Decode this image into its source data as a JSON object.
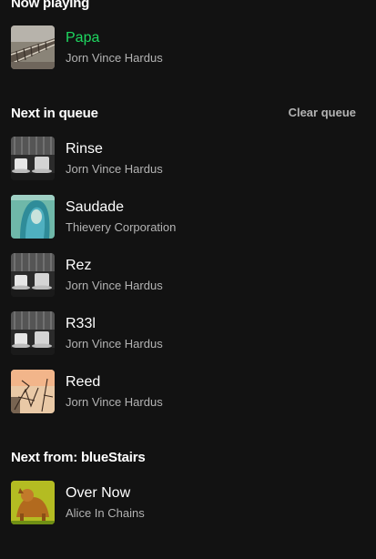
{
  "now_playing": {
    "heading": "Now playing",
    "track": {
      "title": "Papa",
      "artist": "Jorn Vince Hardus",
      "art_icon": "railroad-tracks-artwork"
    }
  },
  "queue": {
    "heading": "Next in queue",
    "clear_label": "Clear queue",
    "items": [
      {
        "title": "Rinse",
        "artist": "Jorn Vince Hardus",
        "art_icon": "coffee-cups-artwork"
      },
      {
        "title": "Saudade",
        "artist": "Thievery Corporation",
        "art_icon": "blue-hair-portrait-artwork"
      },
      {
        "title": "Rez",
        "artist": "Jorn Vince Hardus",
        "art_icon": "coffee-cups-artwork"
      },
      {
        "title": "R33l",
        "artist": "Jorn Vince Hardus",
        "art_icon": "coffee-cups-artwork"
      },
      {
        "title": "Reed",
        "artist": "Jorn Vince Hardus",
        "art_icon": "sketch-artwork"
      }
    ]
  },
  "next_from": {
    "heading": "Next from: blueStairs",
    "items": [
      {
        "title": "Over Now",
        "artist": "Alice In Chains",
        "art_icon": "dog-yellow-artwork"
      }
    ]
  },
  "colors": {
    "background": "#121212",
    "playing_accent": "#1ed760",
    "secondary_text": "#b3b3b3"
  }
}
